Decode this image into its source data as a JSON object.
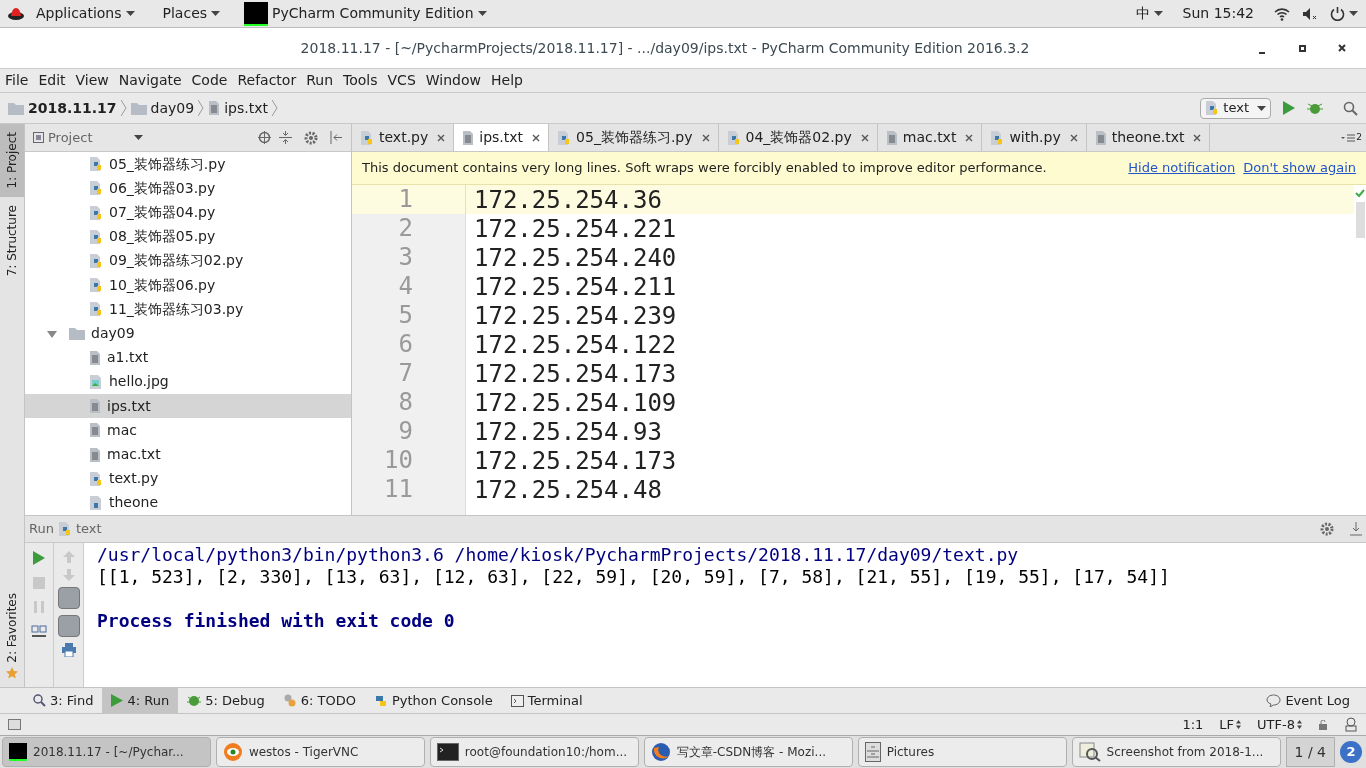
{
  "top_bar": {
    "menus": [
      "Applications",
      "Places"
    ],
    "app": "PyCharm Community Edition",
    "input_method": "中",
    "clock": "Sun 15:42"
  },
  "window": {
    "title": "2018.11.17 - [~/PycharmProjects/2018.11.17] - .../day09/ips.txt - PyCharm Community Edition 2016.3.2"
  },
  "menu": [
    "File",
    "Edit",
    "View",
    "Navigate",
    "Code",
    "Refactor",
    "Run",
    "Tools",
    "VCS",
    "Window",
    "Help"
  ],
  "breadcrumb": [
    {
      "label": "2018.11.17",
      "kind": "folder"
    },
    {
      "label": "day09",
      "kind": "folder"
    },
    {
      "label": "ips.txt",
      "kind": "file"
    }
  ],
  "run_config": "text",
  "side_tabs": [
    {
      "label": "1: Project",
      "selected": true
    },
    {
      "label": "7: Structure",
      "selected": false
    }
  ],
  "favorites_tab": "2: Favorites",
  "project_panel": {
    "title": "Project",
    "tree": [
      {
        "label": "05_装饰器练习.py",
        "kind": "py",
        "selected": false
      },
      {
        "label": "06_装饰器03.py",
        "kind": "py",
        "selected": false
      },
      {
        "label": "07_装饰器04.py",
        "kind": "py",
        "selected": false
      },
      {
        "label": "08_装饰器05.py",
        "kind": "py",
        "selected": false
      },
      {
        "label": "09_装饰器练习02.py",
        "kind": "py",
        "selected": false
      },
      {
        "label": "10_装饰器06.py",
        "kind": "py",
        "selected": false
      },
      {
        "label": "11_装饰器练习03.py",
        "kind": "py",
        "selected": false
      },
      {
        "label": "day09",
        "kind": "folder",
        "selected": false,
        "expanded": true,
        "children": [
          {
            "label": "a1.txt",
            "kind": "txt",
            "selected": false
          },
          {
            "label": "hello.jpg",
            "kind": "img",
            "selected": false
          },
          {
            "label": "ips.txt",
            "kind": "txt",
            "selected": true
          },
          {
            "label": "mac",
            "kind": "txt",
            "selected": false
          },
          {
            "label": "mac.txt",
            "kind": "txt",
            "selected": false
          },
          {
            "label": "text.py",
            "kind": "py",
            "selected": false
          },
          {
            "label": "theone",
            "kind": "unknown",
            "selected": false
          }
        ]
      }
    ]
  },
  "editor_tabs": [
    {
      "label": "text.py",
      "kind": "py",
      "selected": false
    },
    {
      "label": "ips.txt",
      "kind": "txt",
      "selected": true
    },
    {
      "label": "05_装饰器练习.py",
      "kind": "py",
      "selected": false
    },
    {
      "label": "04_装饰器02.py",
      "kind": "py",
      "selected": false
    },
    {
      "label": "mac.txt",
      "kind": "txt",
      "selected": false
    },
    {
      "label": "with.py",
      "kind": "py",
      "selected": false
    },
    {
      "label": "theone.txt",
      "kind": "txt",
      "selected": false
    }
  ],
  "tabs_overflow": "2",
  "notification": {
    "text": "This document contains very long lines. Soft wraps were forcibly enabled to improve editor performance.",
    "links": [
      "Hide notification",
      "Don't show again"
    ]
  },
  "editor_lines": [
    {
      "number": "1",
      "text": "172.25.254.36",
      "current": true
    },
    {
      "number": "2",
      "text": "172.25.254.221",
      "current": false
    },
    {
      "number": "3",
      "text": "172.25.254.240",
      "current": false
    },
    {
      "number": "4",
      "text": "172.25.254.211",
      "current": false
    },
    {
      "number": "5",
      "text": "172.25.254.239",
      "current": false
    },
    {
      "number": "6",
      "text": "172.25.254.122",
      "current": false
    },
    {
      "number": "7",
      "text": "172.25.254.173",
      "current": false
    },
    {
      "number": "8",
      "text": "172.25.254.109",
      "current": false
    },
    {
      "number": "9",
      "text": "172.25.254.93",
      "current": false
    },
    {
      "number": "10",
      "text": "172.25.254.173",
      "current": false
    },
    {
      "number": "11",
      "text": "172.25.254.48",
      "current": false
    }
  ],
  "run_panel": {
    "title": "Run",
    "config": "text",
    "output": [
      {
        "text": "/usr/local/python3/bin/python3.6 /home/kiosk/PycharmProjects/2018.11.17/day09/text.py",
        "kind": "command"
      },
      {
        "text": "[[1, 523], [2, 330], [13, 63], [12, 63], [22, 59], [20, 59], [7, 58], [21, 55], [19, 55], [17, 54]]",
        "kind": "stdout"
      },
      {
        "kind": "blank"
      },
      {
        "text": "Process finished with exit code 0",
        "kind": "system"
      }
    ]
  },
  "tool_windows": [
    {
      "label": "3: Find",
      "kind": "find",
      "selected": false
    },
    {
      "label": "4: Run",
      "kind": "run",
      "selected": true
    },
    {
      "label": "5: Debug",
      "kind": "debug",
      "selected": false
    },
    {
      "label": "6: TODO",
      "kind": "todo",
      "selected": false
    },
    {
      "label": "Python Console",
      "kind": "console",
      "selected": false
    },
    {
      "label": "Terminal",
      "kind": "terminal",
      "selected": false
    }
  ],
  "event_log": "Event Log",
  "status_bar": {
    "position": "1:1",
    "line_sep": "LF",
    "encoding": "UTF-8"
  },
  "taskbar": {
    "items": [
      {
        "label": "2018.11.17 - [~/Pychar...",
        "kind": "pycharm",
        "selected": true
      },
      {
        "label": "westos - TigerVNC",
        "kind": "vnc",
        "selected": false
      },
      {
        "label": "root@foundation10:/hom...",
        "kind": "terminal",
        "selected": false
      },
      {
        "label": "写文章-CSDN博客 - Mozi...",
        "kind": "browser",
        "selected": false
      },
      {
        "label": "Pictures",
        "kind": "files",
        "selected": false
      },
      {
        "label": "Screenshot from 2018-1...",
        "kind": "viewer",
        "selected": false
      }
    ],
    "workspace": "1 / 4",
    "badge": "2"
  }
}
